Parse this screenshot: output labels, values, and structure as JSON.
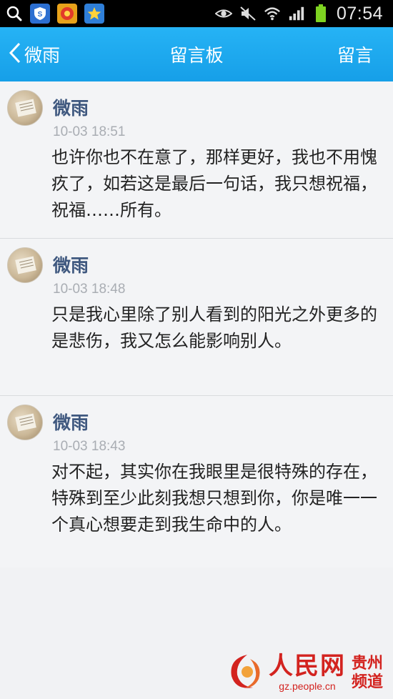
{
  "status_bar": {
    "time": "07:54",
    "apps": [
      "search-icon",
      "qq-security-icon",
      "qzone-icon",
      "star-app-icon"
    ],
    "indicators": [
      "eye-icon",
      "mute-icon",
      "wifi-icon",
      "signal-icon",
      "battery-icon"
    ]
  },
  "header": {
    "back_label": "微雨",
    "title": "留言板",
    "action_label": "留言",
    "color": "#1eaaf0"
  },
  "messages": [
    {
      "author": "微雨",
      "time": "10-03 18:51",
      "text": "也许你也不在意了，那样更好，我也不用愧疚了，如若这是最后一句话，我只想祝福，祝福……所有。"
    },
    {
      "author": "微雨",
      "time": "10-03 18:48",
      "text": "只是我心里除了别人看到的阳光之外更多的是悲伤，我又怎么能影响别人。"
    },
    {
      "author": "微雨",
      "time": "10-03 18:43",
      "text": "对不起，其实你在我眼里是很特殊的存在，特殊到至少此刻我想只想到你，你是唯一一个真心想要走到我生命中的人。"
    }
  ],
  "watermark": {
    "brand": "人民网",
    "url": "gz.people.cn",
    "region": "贵州频道"
  }
}
